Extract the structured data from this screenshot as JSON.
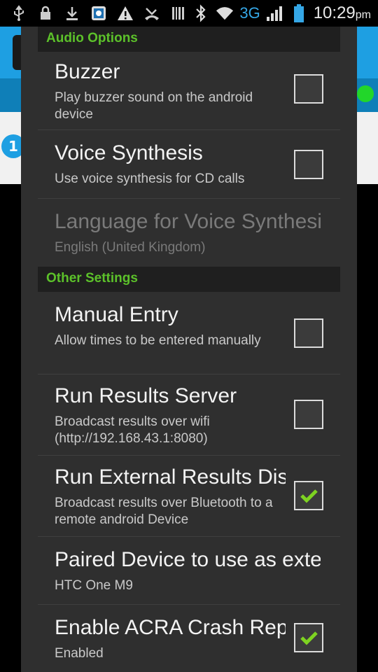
{
  "status_bar": {
    "network": "3G",
    "time": "10:29",
    "ampm": "pm",
    "icons": [
      "usb-icon",
      "lock-icon",
      "download-icon",
      "app-icon",
      "warning-icon",
      "missed-call-icon",
      "barcode-icon",
      "bluetooth-icon",
      "wifi-icon",
      "signal-icon",
      "battery-icon"
    ]
  },
  "background_app": {
    "badge_text": "1",
    "accent": "#1e9fe2"
  },
  "dialog": {
    "sections": [
      {
        "header": "Audio Options",
        "items": [
          {
            "title": "Buzzer",
            "summary": "Play buzzer sound on the android device",
            "checked": false,
            "enabled": true
          },
          {
            "title": "Voice Synthesis",
            "summary": "Use voice synthesis for CD calls",
            "checked": false,
            "enabled": true
          },
          {
            "title": "Language for Voice Synthesis",
            "summary": "English (United Kingdom)",
            "enabled": false
          }
        ]
      },
      {
        "header": "Other Settings",
        "items": [
          {
            "title": "Manual Entry",
            "summary": "Allow times to be entered manually",
            "checked": false,
            "enabled": true
          },
          {
            "title": "Run Results Server",
            "summary": "Broadcast results over wifi (http://192.168.43.1:8080)",
            "checked": false,
            "enabled": true
          },
          {
            "title": "Run External Results Display",
            "summary": "Broadcast results over Bluetooth to a remote android Device",
            "checked": true,
            "enabled": true
          },
          {
            "title": "Paired Device to use as external display",
            "summary": "HTC One M9",
            "enabled": true
          },
          {
            "title": "Enable ACRA Crash Reports",
            "summary": "Enabled",
            "checked": true,
            "enabled": true
          }
        ]
      }
    ],
    "colors": {
      "header_text": "#5cc12a",
      "check": "#7ed321"
    }
  }
}
